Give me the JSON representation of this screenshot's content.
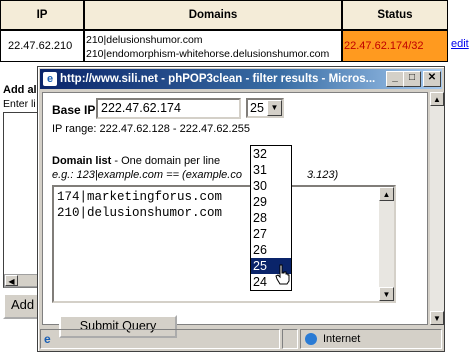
{
  "table": {
    "headers": [
      "IP",
      "Domains",
      "Status"
    ],
    "row": {
      "ip": "22.47.62.210",
      "domains": [
        "210|delusionshumor.com",
        "210|endomorphism-whitehorse.delusionshumor.com"
      ],
      "status": "22.47.62.174/32",
      "edit": "edit"
    }
  },
  "background": {
    "add_label": "Add al",
    "enter_label": "Enter li",
    "add_button": "Add"
  },
  "popup": {
    "title": "http://www.sili.net - phPOP3clean - filter results - Micros...",
    "base_ip_label": "Base IP",
    "base_ip_value": "222.47.62.174",
    "mask_selected": "25",
    "ip_range": "IP range: 222.47.62.128 - 222.47.62.255",
    "domain_list_label": "Domain list",
    "domain_list_hint": " - One domain per line",
    "domain_example": "e.g.: 123|example.com == (example.co",
    "domain_example_tail": "3.123)",
    "domain_lines": [
      "174|marketingforus.com",
      "210|delusionshumor.com"
    ],
    "submit": "Submit Query",
    "mask_options": [
      "32",
      "31",
      "30",
      "29",
      "28",
      "27",
      "26",
      "25",
      "24"
    ],
    "mask_highlighted": "25",
    "status_zone": "Internet"
  },
  "colors": {
    "status_bg": "#ff9a1f",
    "status_text": "#c00000",
    "titlebar": "#0a246a",
    "selection": "#0a246a"
  }
}
